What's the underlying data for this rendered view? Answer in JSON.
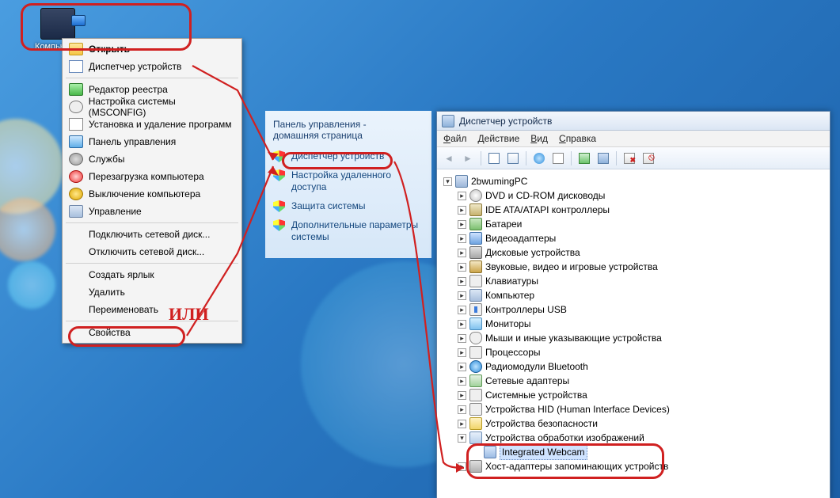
{
  "desktop_icon": {
    "label": "Компьютер"
  },
  "context_menu": {
    "items": [
      {
        "label": "Открыть",
        "ico": "folder",
        "bold": true
      },
      {
        "label": "Диспетчер устройств",
        "ico": "tree"
      },
      {
        "sep": true
      },
      {
        "label": "Редактор реестра",
        "ico": "regedit"
      },
      {
        "label": "Настройка системы (MSCONFIG)",
        "ico": "gears"
      },
      {
        "label": "Установка и удаление программ",
        "ico": "install"
      },
      {
        "label": "Панель управления",
        "ico": "panel"
      },
      {
        "label": "Службы",
        "ico": "svc"
      },
      {
        "label": "Перезагрузка компьютера",
        "ico": "reload"
      },
      {
        "label": "Выключение компьютера",
        "ico": "power"
      },
      {
        "label": "Управление",
        "ico": "mgmt"
      },
      {
        "sep": true
      },
      {
        "label": "Подключить сетевой диск...",
        "ico": ""
      },
      {
        "label": "Отключить сетевой диск...",
        "ico": ""
      },
      {
        "sep": true
      },
      {
        "label": "Создать ярлык",
        "ico": ""
      },
      {
        "label": "Удалить",
        "ico": ""
      },
      {
        "label": "Переименовать",
        "ico": ""
      },
      {
        "sep": true
      },
      {
        "label": "Свойства",
        "ico": ""
      }
    ]
  },
  "control_panel": {
    "heading1": "Панель управления -",
    "heading2": "домашняя страница",
    "links": [
      {
        "label": "Диспетчер устройств",
        "shield": true
      },
      {
        "label": "Настройка удаленного доступа",
        "shield": true
      },
      {
        "label": "Защита системы",
        "shield": true
      },
      {
        "label": "Дополнительные параметры системы",
        "shield": true
      }
    ]
  },
  "device_manager": {
    "title": "Диспетчер устройств",
    "menubar": [
      "Файл",
      "Действие",
      "Вид",
      "Справка"
    ],
    "root": {
      "label": "2bwumingPC"
    },
    "categories": [
      {
        "label": "DVD и CD-ROM дисководы",
        "ico": "cd"
      },
      {
        "label": "IDE ATA/ATAPI контроллеры",
        "ico": "ide"
      },
      {
        "label": "Батареи",
        "ico": "bat"
      },
      {
        "label": "Видеоадаптеры",
        "ico": "vid"
      },
      {
        "label": "Дисковые устройства",
        "ico": "disk"
      },
      {
        "label": "Звуковые, видео и игровые устройства",
        "ico": "snd"
      },
      {
        "label": "Клавиатуры",
        "ico": "kb"
      },
      {
        "label": "Компьютер",
        "ico": "comp"
      },
      {
        "label": "Контроллеры USB",
        "ico": "usb"
      },
      {
        "label": "Мониторы",
        "ico": "mon"
      },
      {
        "label": "Мыши и иные указывающие устройства",
        "ico": "mouse"
      },
      {
        "label": "Процессоры",
        "ico": "cpu"
      },
      {
        "label": "Радиомодули Bluetooth",
        "ico": "bt"
      },
      {
        "label": "Сетевые адаптеры",
        "ico": "net"
      },
      {
        "label": "Системные устройства",
        "ico": "sys"
      },
      {
        "label": "Устройства HID (Human Interface Devices)",
        "ico": "hid"
      },
      {
        "label": "Устройства безопасности",
        "ico": "sec"
      }
    ],
    "imaging": {
      "label": "Устройства обработки изображений",
      "child": "Integrated Webcam"
    },
    "last": {
      "label": "Хост-адаптеры запоминающих устройств",
      "ico": "host"
    }
  },
  "annotations": {
    "or_label": "ИЛИ"
  }
}
